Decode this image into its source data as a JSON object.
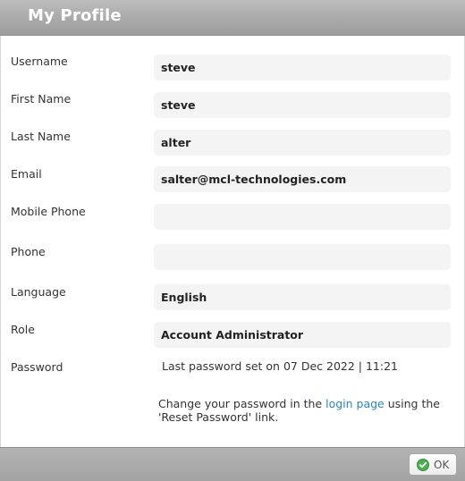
{
  "dialog": {
    "title": "My Profile"
  },
  "fields": {
    "username": {
      "label": "Username",
      "value": "steve"
    },
    "first_name": {
      "label": "First Name",
      "value": "steve"
    },
    "last_name": {
      "label": "Last Name",
      "value": "alter"
    },
    "email": {
      "label": "Email",
      "value": "salter@mcl-technologies.com"
    },
    "mobile_phone": {
      "label": "Mobile Phone",
      "value": ""
    },
    "phone": {
      "label": "Phone",
      "value": ""
    },
    "language": {
      "label": "Language",
      "value": "English"
    },
    "role": {
      "label": "Role",
      "value": "Account Administrator"
    },
    "password": {
      "label": "Password",
      "info": "Last password set on 07 Dec 2022 | 11:21"
    }
  },
  "help": {
    "prefix": "Change your password in the ",
    "link_text": "login page",
    "suffix": " using the 'Reset Password' link."
  },
  "footer": {
    "ok_label": "OK"
  },
  "colors": {
    "titlebar": "#a9a9a9",
    "link": "#2a86c2",
    "ok_icon": "#4caf50"
  },
  "icons": {
    "ok": "check-circle-icon"
  }
}
